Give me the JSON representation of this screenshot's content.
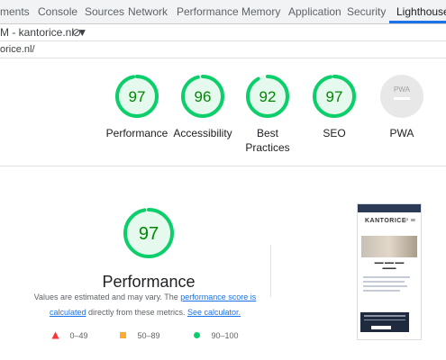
{
  "devtools_tabs": [
    {
      "label": "ments"
    },
    {
      "label": "Console"
    },
    {
      "label": "Sources"
    },
    {
      "label": "Network"
    },
    {
      "label": "Performance"
    },
    {
      "label": "Memory"
    },
    {
      "label": "Application"
    },
    {
      "label": "Security"
    },
    {
      "label": "Lighthouse",
      "active": true
    }
  ],
  "report_selector": {
    "text": "M - kantorice.nl ▼",
    "clear_icon": "⊘"
  },
  "url": "orice.nl/",
  "categories": [
    {
      "score": "97",
      "label": "Performance",
      "value": 97,
      "color": "#0cce6b",
      "text_color": "#008800"
    },
    {
      "score": "96",
      "label": "Accessibility",
      "value": 96,
      "color": "#0cce6b",
      "text_color": "#008800"
    },
    {
      "score": "92",
      "label": "Best Practices",
      "value": 92,
      "color": "#0cce6b",
      "text_color": "#008800"
    },
    {
      "score": "97",
      "label": "SEO",
      "value": 97,
      "color": "#0cce6b",
      "text_color": "#008800"
    },
    {
      "score": "PWA",
      "label": "PWA",
      "value": 0,
      "color": "#c4c4c4",
      "text_color": "#9e9e9e"
    }
  ],
  "performance": {
    "score": "97",
    "title": "Performance",
    "desc_pre": "Values are estimated and may vary. The ",
    "desc_link1": "performance score is calculated",
    "desc_mid": " directly from these metrics. ",
    "desc_link2": "See calculator."
  },
  "legend": [
    {
      "range": "0–49",
      "color": "#ff3333"
    },
    {
      "range": "50–89",
      "color": "#ffaa33"
    },
    {
      "range": "90–100",
      "color": "#0cce6b"
    }
  ],
  "screenshot": {
    "logo": "KANTORICE"
  }
}
